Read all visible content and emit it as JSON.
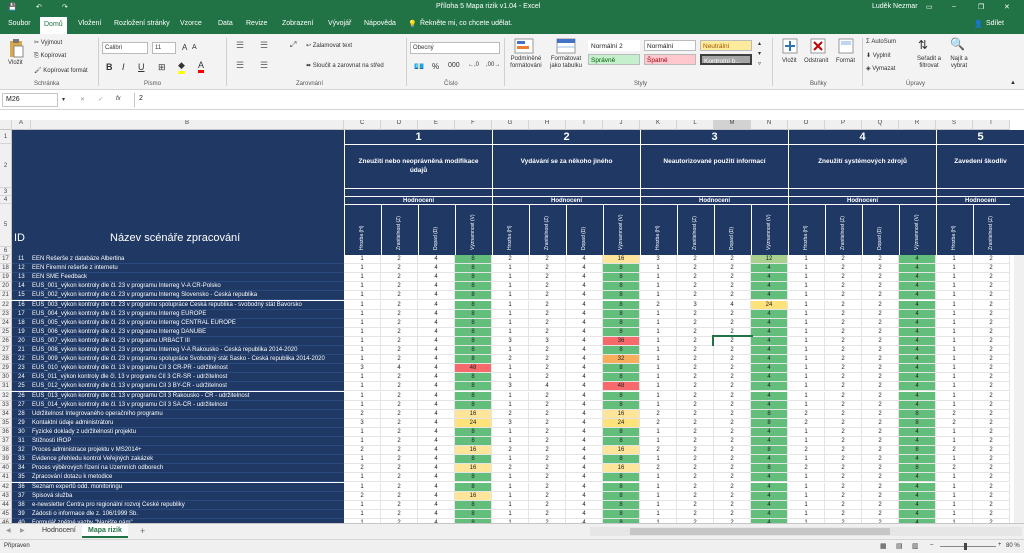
{
  "titlebar": {
    "save": "💾",
    "undo": "↶",
    "redo": "↷",
    "title": "Příloha 5 Mapa rizik v1.04  -  Excel",
    "user": "Luděk Nezmar"
  },
  "ribbon_tabs": [
    "Soubor",
    "Domů",
    "Vložení",
    "Rozložení stránky",
    "Vzorce",
    "Data",
    "Revize",
    "Zobrazení",
    "Vývojář",
    "Nápověda"
  ],
  "tellme": "Řekněte mi, co chcete udělat.",
  "share": "Sdílet",
  "ribbon": {
    "paste": "Vložit",
    "cut": "Vyjmout",
    "copy": "Kopírovat",
    "format_painter": "Kopírovat formát",
    "g_clipboard": "Schránka",
    "font_name": "Calibri",
    "font_size": "11",
    "g_font": "Písmo",
    "wrap": "Zalamovat text",
    "merge": "Sloučit a zarovnat na střed",
    "g_align": "Zarovnání",
    "number_format": "Obecný",
    "g_number": "Číslo",
    "cond_format": "Podmíněné formátování",
    "format_table": "Formátovat jako tabulku",
    "styles": [
      "Normální 2",
      "Normální",
      "Neutrální",
      "Správně",
      "Špatně",
      "Kontrolní b..."
    ],
    "g_styles": "Styly",
    "insert": "Vložit",
    "delete": "Odstranit",
    "format": "Formát",
    "g_cells": "Buňky",
    "autosum": "AutoSum",
    "fill": "Vyplnit",
    "clear": "Vymazat",
    "sort": "Seřadit a filtrovat",
    "find": "Najít a vybrat",
    "g_edit": "Úpravy"
  },
  "formula_bar": {
    "namebox": "M26",
    "cancel": "✕",
    "enter": "✓",
    "fx": "fx",
    "value": "2"
  },
  "columns": [
    "A",
    "B",
    "C",
    "D",
    "E",
    "F",
    "G",
    "H",
    "I",
    "J",
    "K",
    "L",
    "M",
    "N",
    "O",
    "P",
    "Q",
    "R",
    "S",
    "T"
  ],
  "header": {
    "row_numbers": [
      "1",
      "2",
      "3",
      "4",
      "5",
      "6"
    ],
    "id_label": "ID",
    "name_label": "Název scénáře zpracování",
    "groups": [
      {
        "num": "1",
        "title": "Zneužití nebo neoprávněná modifikace údajů"
      },
      {
        "num": "2",
        "title": "Vydávání se za někoho jiného"
      },
      {
        "num": "3",
        "title": "Neautorizované použití informací"
      },
      {
        "num": "4",
        "title": "Zneužití systémových zdrojů"
      },
      {
        "num": "5",
        "title": "Zavedení škodliv"
      }
    ],
    "hodnoceni": "Hodnocení",
    "sub": [
      "Hrozba (H)",
      "Zranitelnost (Z)",
      "Dopad (D)",
      "Významnost (V)"
    ]
  },
  "rows": [
    {
      "r": "17",
      "id": "11",
      "name": "EEN Rešerše z databáze Albertina",
      "v": [
        "1",
        "2",
        "4",
        "8",
        "2",
        "2",
        "4",
        "16",
        "3",
        "2",
        "2",
        "12",
        "1",
        "2",
        "2",
        "4",
        "1",
        "2"
      ]
    },
    {
      "r": "18",
      "id": "12",
      "name": "EEN Firemní rešerše z internetu",
      "v": [
        "1",
        "2",
        "4",
        "8",
        "1",
        "2",
        "4",
        "8",
        "1",
        "2",
        "2",
        "4",
        "1",
        "2",
        "2",
        "4",
        "1",
        "2"
      ]
    },
    {
      "r": "19",
      "id": "13",
      "name": "EEN SME Feedback",
      "v": [
        "1",
        "2",
        "4",
        "8",
        "1",
        "2",
        "4",
        "8",
        "1",
        "2",
        "2",
        "4",
        "1",
        "2",
        "2",
        "4",
        "1",
        "2"
      ]
    },
    {
      "r": "20",
      "id": "14",
      "name": "EUS_001_výkon kontroly dle čl. 23 v programu Interreg V-A CR-Polsko",
      "v": [
        "1",
        "2",
        "4",
        "8",
        "1",
        "2",
        "4",
        "8",
        "1",
        "2",
        "2",
        "4",
        "1",
        "2",
        "2",
        "4",
        "1",
        "2"
      ]
    },
    {
      "r": "21",
      "id": "15",
      "name": "EUS_002_výkon kontroly dle čl. 23 v programu Interreg Slovensko - Česká republika",
      "v": [
        "1",
        "2",
        "4",
        "8",
        "1",
        "2",
        "4",
        "8",
        "1",
        "2",
        "2",
        "4",
        "1",
        "2",
        "2",
        "4",
        "1",
        "2"
      ]
    },
    {
      "r": "22",
      "id": "16",
      "name": "EUS_003_výkon kontroly dle čl. 23 v programu spolupráce Česká republika - svobodný stát Bavorsko",
      "v": [
        "1",
        "2",
        "4",
        "8",
        "1",
        "2",
        "4",
        "8",
        "2",
        "3",
        "4",
        "24",
        "1",
        "2",
        "2",
        "4",
        "1",
        "2"
      ]
    },
    {
      "r": "23",
      "id": "17",
      "name": "EUS_004_výkon kontroly dle čl. 23 v programu Interreg EUROPE",
      "v": [
        "1",
        "2",
        "4",
        "8",
        "1",
        "2",
        "4",
        "8",
        "1",
        "2",
        "2",
        "4",
        "1",
        "2",
        "2",
        "4",
        "1",
        "2"
      ]
    },
    {
      "r": "24",
      "id": "18",
      "name": "EUS_005_výkon kontroly dle čl. 23 v programu Interreg CENTRAL EUROPE",
      "v": [
        "1",
        "2",
        "4",
        "8",
        "1",
        "2",
        "4",
        "8",
        "1",
        "2",
        "2",
        "4",
        "1",
        "2",
        "2",
        "4",
        "1",
        "2"
      ]
    },
    {
      "r": "25",
      "id": "19",
      "name": "EUS_006_výkon kontroly dle čl. 23 v programu Interreg DANUBE",
      "v": [
        "1",
        "2",
        "4",
        "8",
        "1",
        "2",
        "4",
        "8",
        "1",
        "2",
        "2",
        "4",
        "1",
        "2",
        "2",
        "4",
        "1",
        "2"
      ]
    },
    {
      "r": "26",
      "id": "20",
      "name": "EUS_007_výkon kontroly dle čl. 23 v programu URBACT III",
      "v": [
        "1",
        "2",
        "4",
        "8",
        "3",
        "3",
        "4",
        "36",
        "1",
        "2",
        "2",
        "4",
        "1",
        "2",
        "2",
        "4",
        "1",
        "2"
      ]
    },
    {
      "r": "27",
      "id": "21",
      "name": "EUS_008_výkon kontroly dle čl. 23 v programu Interreg V-A Rakousko - Česká republika 2014-2020",
      "v": [
        "1",
        "2",
        "4",
        "8",
        "1",
        "2",
        "4",
        "8",
        "1",
        "2",
        "2",
        "4",
        "1",
        "2",
        "2",
        "4",
        "1",
        "2"
      ]
    },
    {
      "r": "28",
      "id": "22",
      "name": "EUS_009_výkon kontroly dle čl. 23 v programu spolupráce Svobodný stát Sasko - Česká republika 2014-2020",
      "v": [
        "1",
        "2",
        "4",
        "8",
        "2",
        "2",
        "4",
        "32",
        "1",
        "2",
        "2",
        "4",
        "1",
        "2",
        "2",
        "4",
        "1",
        "2"
      ]
    },
    {
      "r": "29",
      "id": "23",
      "name": "EUS_010_výkon kontroly dle čl. 13 v programu Cíl 3 CR-PR - udržitelnost",
      "v": [
        "3",
        "4",
        "4",
        "48",
        "1",
        "2",
        "4",
        "8",
        "1",
        "2",
        "2",
        "4",
        "1",
        "2",
        "2",
        "4",
        "1",
        "2"
      ]
    },
    {
      "r": "30",
      "id": "24",
      "name": "EUS_011_výkon kontroly dle čl. 13 v programu Cíl 3 CR-SR - udržitelnost",
      "v": [
        "1",
        "2",
        "4",
        "8",
        "1",
        "2",
        "4",
        "8",
        "1",
        "2",
        "2",
        "4",
        "1",
        "2",
        "2",
        "4",
        "1",
        "2"
      ]
    },
    {
      "r": "31",
      "id": "25",
      "name": "EUS_012_výkon kontroly dle čl. 13 v programu Cíl 3 BY-CR - udržitelnost",
      "v": [
        "1",
        "2",
        "4",
        "8",
        "3",
        "4",
        "4",
        "48",
        "1",
        "2",
        "2",
        "4",
        "1",
        "2",
        "2",
        "4",
        "1",
        "2"
      ]
    },
    {
      "r": "32",
      "id": "26",
      "name": "EUS_013_výkon kontroly dle čl. 13 v programu Cíl 3 Rakousko - CR - udržitelnost",
      "v": [
        "1",
        "2",
        "4",
        "8",
        "1",
        "2",
        "4",
        "8",
        "1",
        "2",
        "2",
        "4",
        "1",
        "2",
        "2",
        "4",
        "1",
        "2"
      ]
    },
    {
      "r": "33",
      "id": "27",
      "name": "EUS_014_výkon kontroly dle čl. 13 v programu Cíl 3 SA-CR - udržitelnost",
      "v": [
        "1",
        "2",
        "4",
        "8",
        "1",
        "2",
        "4",
        "8",
        "1",
        "2",
        "2",
        "4",
        "1",
        "2",
        "2",
        "4",
        "1",
        "2"
      ]
    },
    {
      "r": "34",
      "id": "28",
      "name": "Udržitelnost Integrovaného operačního programu",
      "v": [
        "2",
        "2",
        "4",
        "16",
        "2",
        "2",
        "4",
        "16",
        "2",
        "2",
        "2",
        "8",
        "2",
        "2",
        "2",
        "8",
        "2",
        "2"
      ]
    },
    {
      "r": "35",
      "id": "29",
      "name": "Kontaktní údaje administrátoru",
      "v": [
        "3",
        "2",
        "4",
        "24",
        "3",
        "2",
        "4",
        "24",
        "2",
        "2",
        "2",
        "8",
        "2",
        "2",
        "2",
        "8",
        "2",
        "2"
      ]
    },
    {
      "r": "36",
      "id": "30",
      "name": "Fyzické doklady z udržitelnosti projektu",
      "v": [
        "1",
        "2",
        "4",
        "8",
        "1",
        "2",
        "4",
        "8",
        "1",
        "2",
        "2",
        "4",
        "1",
        "2",
        "2",
        "4",
        "1",
        "2"
      ]
    },
    {
      "r": "37",
      "id": "31",
      "name": "Stížnosti IROP",
      "v": [
        "1",
        "2",
        "4",
        "8",
        "1",
        "2",
        "4",
        "8",
        "1",
        "2",
        "2",
        "4",
        "1",
        "2",
        "2",
        "4",
        "1",
        "2"
      ]
    },
    {
      "r": "38",
      "id": "32",
      "name": "Proces administrace projektu v MS2014+",
      "v": [
        "2",
        "2",
        "4",
        "16",
        "2",
        "2",
        "4",
        "16",
        "2",
        "2",
        "2",
        "8",
        "2",
        "2",
        "2",
        "8",
        "2",
        "2"
      ]
    },
    {
      "r": "39",
      "id": "33",
      "name": "Evidence přehledu kontrol Veřejných zakázek",
      "v": [
        "1",
        "2",
        "4",
        "8",
        "1",
        "2",
        "4",
        "8",
        "1",
        "2",
        "2",
        "4",
        "1",
        "2",
        "2",
        "4",
        "1",
        "2"
      ]
    },
    {
      "r": "40",
      "id": "34",
      "name": "Proces výběrových řízení na Územních odborech",
      "v": [
        "2",
        "2",
        "4",
        "16",
        "2",
        "2",
        "4",
        "16",
        "2",
        "2",
        "2",
        "8",
        "2",
        "2",
        "2",
        "8",
        "2",
        "2"
      ]
    },
    {
      "r": "41",
      "id": "35",
      "name": "Zpracování dotazu k metodice",
      "v": [
        "1",
        "2",
        "4",
        "8",
        "1",
        "2",
        "4",
        "8",
        "1",
        "2",
        "2",
        "4",
        "1",
        "2",
        "2",
        "4",
        "1",
        "2"
      ]
    },
    {
      "r": "42",
      "id": "36",
      "name": "Seznam expertů odd. monitoringu",
      "v": [
        "1",
        "2",
        "4",
        "8",
        "1",
        "2",
        "4",
        "8",
        "1",
        "2",
        "2",
        "4",
        "1",
        "2",
        "2",
        "4",
        "1",
        "2"
      ]
    },
    {
      "r": "43",
      "id": "37",
      "name": "Spisová služba",
      "v": [
        "2",
        "2",
        "4",
        "16",
        "1",
        "2",
        "4",
        "8",
        "1",
        "2",
        "2",
        "4",
        "1",
        "2",
        "2",
        "4",
        "1",
        "2"
      ]
    },
    {
      "r": "44",
      "id": "38",
      "name": "e-newsletter Centra pro regionální rozvoj České republiky",
      "v": [
        "1",
        "2",
        "4",
        "8",
        "1",
        "2",
        "4",
        "8",
        "1",
        "2",
        "2",
        "4",
        "1",
        "2",
        "2",
        "4",
        "1",
        "2"
      ]
    },
    {
      "r": "45",
      "id": "39",
      "name": "Žádosti o informace dle z. 106/1999 Sb.",
      "v": [
        "1",
        "2",
        "4",
        "8",
        "1",
        "2",
        "4",
        "8",
        "1",
        "2",
        "2",
        "4",
        "1",
        "2",
        "2",
        "4",
        "1",
        "2"
      ]
    },
    {
      "r": "46",
      "id": "40",
      "name": "Formulář zpětné vazby \"Napište nám\"",
      "v": [
        "1",
        "2",
        "4",
        "8",
        "1",
        "2",
        "4",
        "8",
        "1",
        "2",
        "2",
        "4",
        "1",
        "2",
        "2",
        "4",
        "1",
        "2"
      ]
    }
  ],
  "sheet_tabs": [
    "Hodnocení",
    "Mapa rizik"
  ],
  "add_sheet": "+",
  "status": {
    "ready": "Připraven",
    "zoom": "80 %"
  },
  "colors": {
    "excel_green": "#217346",
    "navy": "#1f3864",
    "green": "#63be7b",
    "light_green": "#a9d08e",
    "yellow": "#ffe27a",
    "orange": "#f8ae5b",
    "red": "#f8696b"
  }
}
